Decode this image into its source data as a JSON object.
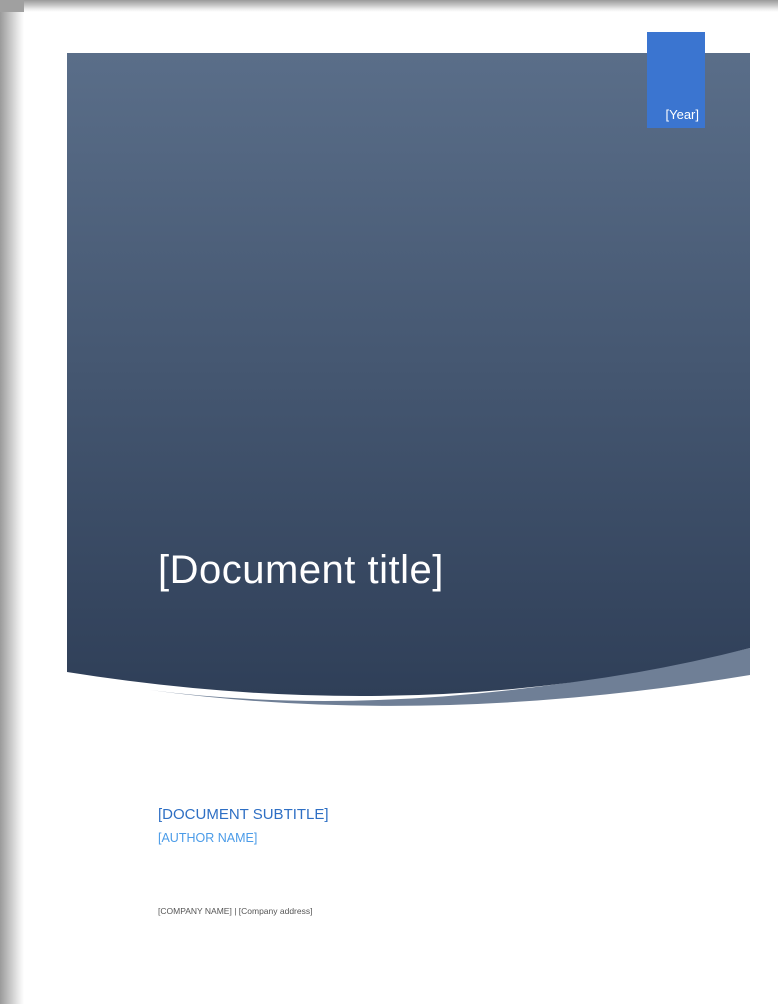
{
  "cover": {
    "year": "[Year]",
    "title": "[Document title]",
    "subtitle": "[DOCUMENT SUBTITLE]",
    "author": "[AUTHOR NAME]",
    "company_line": "[COMPANY NAME] | [Company address]"
  },
  "colors": {
    "banner_top": "#5a6e89",
    "banner_bottom": "#2f3f58",
    "swoosh": "#6f7f96",
    "year_block": "#3b75d0",
    "subtitle": "#2e6fc4",
    "author": "#4a9be8"
  }
}
